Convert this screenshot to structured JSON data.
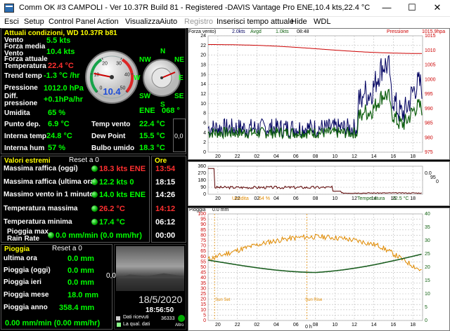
{
  "window": {
    "title": "Comm OK #3 CAMPOLI - Ver 10.37R Build 81 - Registered  -DAVIS Vantage Pro ENE,10.4 kts,22.4 °C",
    "min": "—",
    "max": "☐",
    "close": "✕"
  },
  "menu": [
    "Esci",
    "Setup",
    "Control Panel",
    "Action",
    "Visualizza",
    "Aiuto",
    "Registro",
    "Inserisci tempo attuale",
    "Hide",
    "WDL"
  ],
  "current": {
    "title": "Attuali condizioni, WD 10.37R b81",
    "rows": [
      {
        "label": "Vento",
        "value": "5.5 kts"
      },
      {
        "label": "Forza media Vento",
        "value": "10.4 kts"
      },
      {
        "label": "Forza attuale",
        "value": ""
      },
      {
        "label": "Temperatura",
        "value": "22.4 °C"
      },
      {
        "label": "Trend temp",
        "value": "-1.3 °C /hr"
      },
      {
        "label": "Pressione",
        "value": "1012.0 hPa"
      },
      {
        "label": "Diff. pressione",
        "value": "+0.1hPa/hr"
      },
      {
        "label": "Umidita",
        "value": "65 %"
      }
    ],
    "gauge_speed": "10.4",
    "gauge_ticks": [
      "0",
      "10",
      "20",
      "30",
      "40",
      "50"
    ],
    "gauge_level": 0.21,
    "compass": [
      "N",
      "NE",
      "E",
      "SE",
      "S",
      "SW",
      "W",
      "NW"
    ],
    "direction": "ENE",
    "direction_deg": "068 °",
    "left2": [
      {
        "label": "Punto dep.",
        "value": "6.9 °C"
      },
      {
        "label": "Interna temp.",
        "value": "24.8 °C"
      },
      {
        "label": "Interna hum",
        "value": "57 %"
      }
    ],
    "right2": [
      {
        "label": "Temp vento",
        "value": "22.4 °C"
      },
      {
        "label": "Dew Point",
        "value": "15.5 °C"
      },
      {
        "label": "Bulbo umido",
        "value": "18.3 °C"
      }
    ],
    "side_value": "0,0"
  },
  "extremes": {
    "title": "Valori estremi",
    "reset": "Reset a 0",
    "ore": "Ore",
    "rows": [
      {
        "label": "Massima raffica (oggi)",
        "value": "18.3 kts ENE",
        "time": "13:54",
        "color": "red"
      },
      {
        "label": "Massima raffica (ultima ora)",
        "value": "12.2 kts   0",
        "time": "18:15",
        "color": "green"
      },
      {
        "label": "Massimo vento in 1 minuto",
        "value": "14.0 kts ENE",
        "time": "14:26",
        "color": "green"
      },
      {
        "label": "Temperatura massima",
        "value": "26.2 °C",
        "time": "14:12",
        "color": "red"
      },
      {
        "label": "Temperatura minima",
        "value": "17.4 °C",
        "time": "06:12",
        "color": "green"
      },
      {
        "label": "Pioggia max Rain Rate",
        "value": "0.0 mm/min (0.0 mm/hr)",
        "time": "00:00",
        "color": "green"
      }
    ]
  },
  "rain": {
    "title": "Pioggia",
    "reset": "Reset a 0",
    "rows": [
      {
        "label": "ultima ora",
        "value": "0.0 mm"
      },
      {
        "label": "Pioggia (oggi)",
        "value": "0.0 mm"
      },
      {
        "label": "Pioggia ieri",
        "value": "0.0 mm"
      },
      {
        "label": "Pioggia mese",
        "value": "18.0 mm"
      },
      {
        "label": "Pioggia anno",
        "value": "358.4 mm"
      }
    ],
    "rate": "0.00 mm/min (0.00 mm/hr)"
  },
  "webcam": {
    "side": "0,0",
    "date": "18/5/2020",
    "time": "18:56:50",
    "dati_ricevuti": "Dati ricevuti",
    "qual_dati": "La qual. dati",
    "count": "36333",
    "arrow_label": "Altro"
  },
  "chart1": {
    "header": [
      "Forza vento)",
      "2.0kts",
      "Avgd",
      "1.0kts",
      "08:48",
      "Pressione",
      "1015.9hpa"
    ],
    "yleft": [
      "24",
      "22",
      "20",
      "18",
      "16",
      "14",
      "12",
      "10",
      "8",
      "6",
      "4",
      "2",
      "0"
    ],
    "yright": [
      "1015",
      "1010",
      "1005",
      "1000",
      "995",
      "990",
      "985",
      "980",
      "975"
    ],
    "x": [
      "20",
      "22",
      "02",
      "04",
      "06",
      "08",
      "10",
      "12",
      "14",
      "16",
      "18"
    ]
  },
  "chart2": {
    "yleft": [
      "360",
      "270",
      "180",
      "90",
      "0"
    ],
    "yright": [
      "0.0",
      "95",
      "0"
    ],
    "x": [
      "20",
      "22",
      "02",
      "04",
      "06",
      "08",
      "10",
      "12",
      "14",
      "16",
      "18"
    ],
    "umidita_label": "Umidita",
    "umidita_value": "64 %",
    "temp_label": "Temperatura",
    "temp_value": "22.5 °C"
  },
  "chart3": {
    "header": [
      "Pioggia",
      "0.0 mm"
    ],
    "yleft": [
      "100",
      "95",
      "90",
      "85",
      "80",
      "75",
      "70",
      "65",
      "60",
      "55",
      "50",
      "45",
      "40",
      "35",
      "30",
      "25",
      "20",
      "15",
      "10",
      "5",
      "0"
    ],
    "yright": [
      "40",
      "35",
      "30",
      "25",
      "20",
      "15",
      "10",
      "5",
      "0"
    ],
    "x": [
      "20",
      "22",
      "02",
      "04",
      "06",
      "08",
      "10",
      "12",
      "14",
      "16",
      "18"
    ],
    "sunset": "Sun Set",
    "sunrise": "Sun Rise",
    "midnight": "0 h"
  },
  "colors": {
    "yellow": "#ffff00",
    "green": "#00ff00",
    "red": "#ff3030",
    "navy": "#000060",
    "darkgreen": "#106010",
    "orange": "#e08a00"
  }
}
